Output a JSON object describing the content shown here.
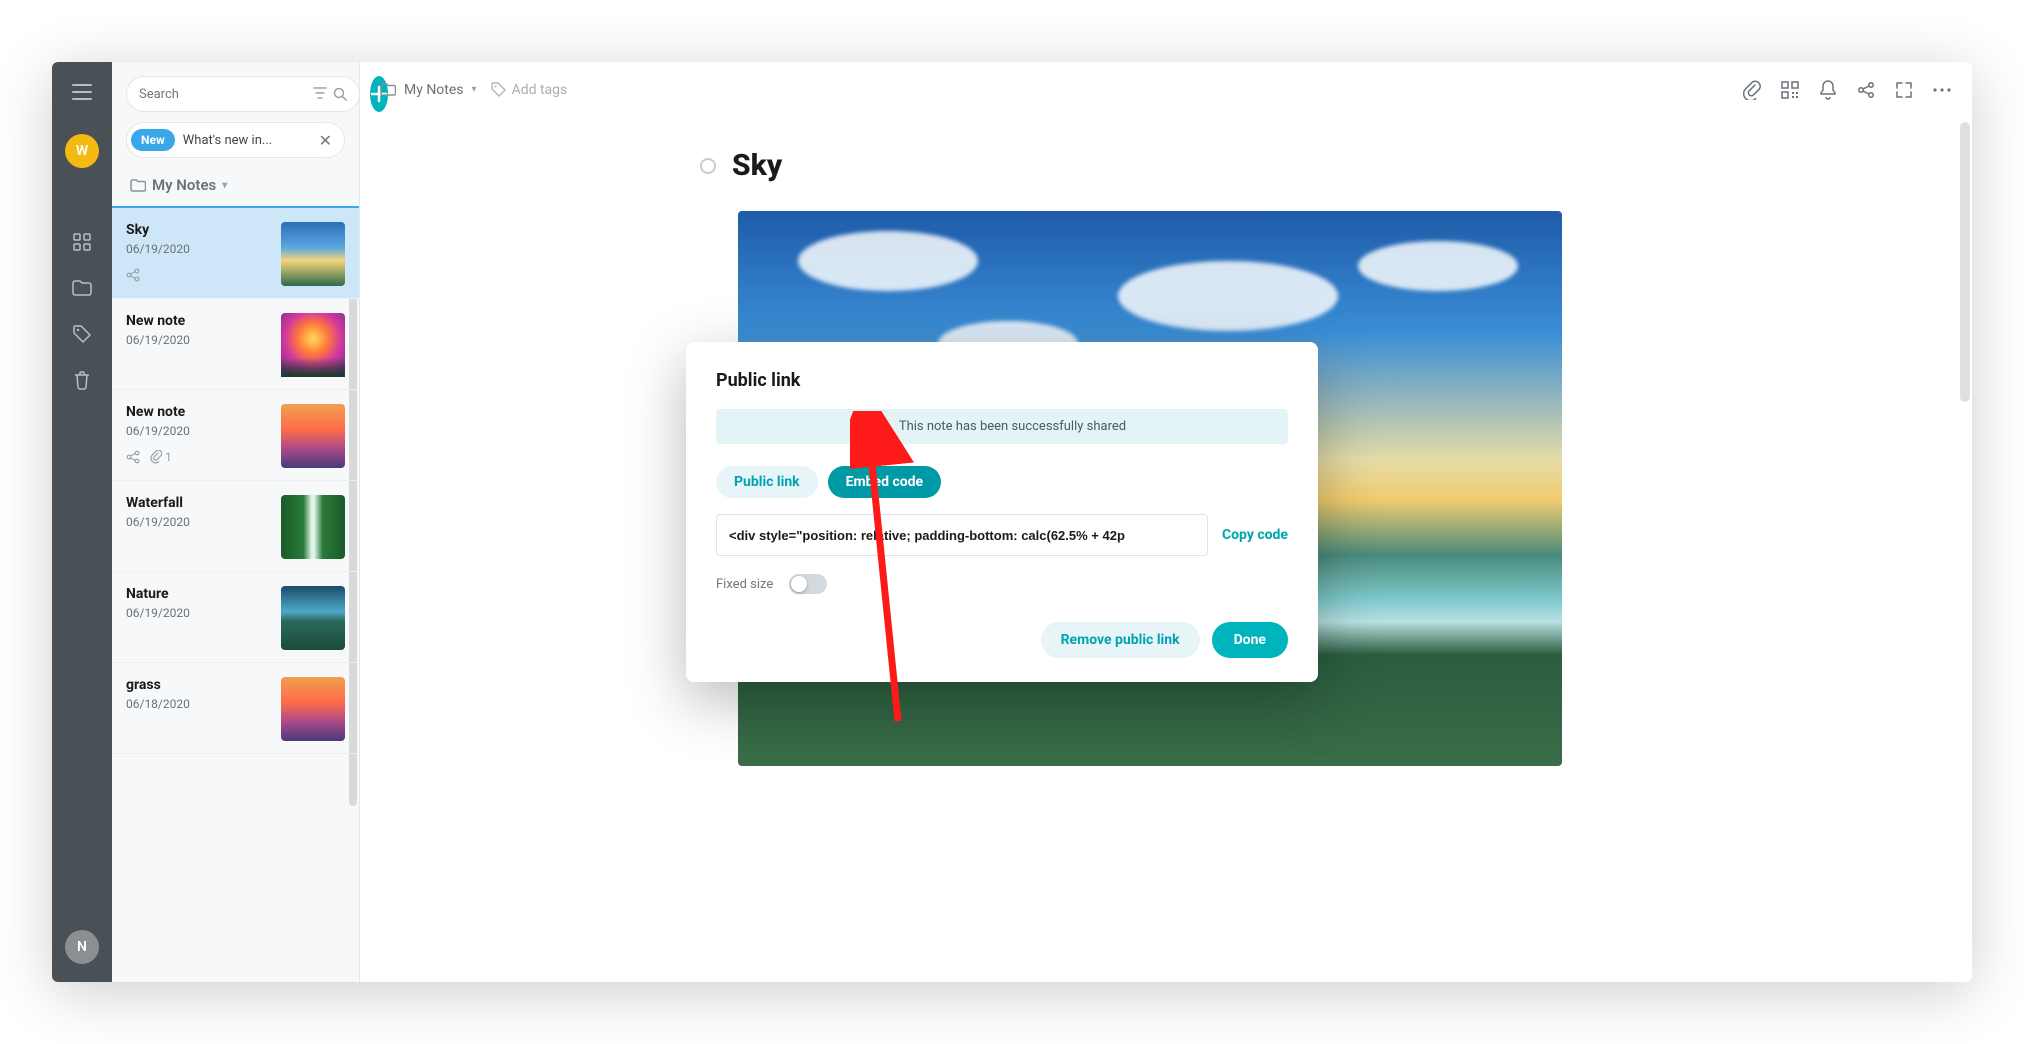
{
  "rail": {
    "avatar_w": "W",
    "avatar_n": "N"
  },
  "search": {
    "placeholder": "Search"
  },
  "whatsnew": {
    "badge": "New",
    "text": "What's new in..."
  },
  "folder": {
    "label": "My Notes"
  },
  "notes": [
    {
      "title": "Sky",
      "date": "06/19/2020",
      "thumb": "th-sky",
      "active": true,
      "shared": true
    },
    {
      "title": "New note",
      "date": "06/19/2020",
      "thumb": "th-sunset"
    },
    {
      "title": "New note",
      "date": "06/19/2020",
      "thumb": "th-city",
      "shared": true,
      "attach_count": "1"
    },
    {
      "title": "Waterfall",
      "date": "06/19/2020",
      "thumb": "th-waterfall"
    },
    {
      "title": "Nature",
      "date": "06/19/2020",
      "thumb": "th-nature"
    },
    {
      "title": "grass",
      "date": "06/18/2020",
      "thumb": "th-city"
    }
  ],
  "breadcrumb": {
    "folder": "My Notes"
  },
  "tags": {
    "add_text": "Add tags"
  },
  "note": {
    "title": "Sky"
  },
  "modal": {
    "title": "Public link",
    "success": "This note has been successfully shared",
    "tab_public": "Public link",
    "tab_embed": "Embed code",
    "code_value": "<div style=\"position: relative; padding-bottom: calc(62.5% + 42p",
    "copy": "Copy code",
    "fixed": "Fixed size",
    "remove": "Remove public link",
    "done": "Done"
  }
}
